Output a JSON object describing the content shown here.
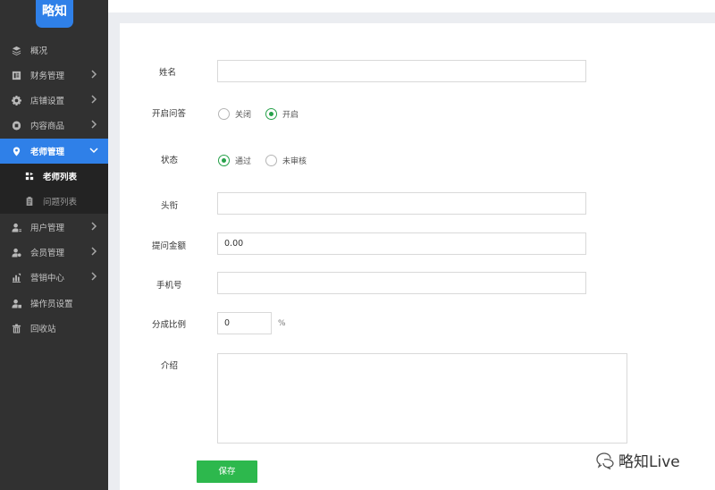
{
  "sidebar": {
    "logo_text": "略知",
    "items": [
      {
        "label": "概况",
        "icon": "layers-icon"
      },
      {
        "label": "财务管理",
        "icon": "ledger-icon"
      },
      {
        "label": "店铺设置",
        "icon": "gear-icon"
      },
      {
        "label": "内容商品",
        "icon": "product-icon"
      },
      {
        "label": "老师管理",
        "icon": "location-pin-icon",
        "active": true
      },
      {
        "label": "用户管理",
        "icon": "user-icon"
      },
      {
        "label": "会员管理",
        "icon": "member-icon"
      },
      {
        "label": "营销中心",
        "icon": "chart-icon"
      },
      {
        "label": "操作员设置",
        "icon": "operator-icon"
      },
      {
        "label": "回收站",
        "icon": "trash-icon"
      }
    ],
    "sub_items": [
      {
        "label": "老师列表",
        "icon": "teacher-list-icon",
        "current": true
      },
      {
        "label": "问题列表",
        "icon": "clipboard-icon"
      }
    ]
  },
  "form": {
    "name_label": "姓名",
    "name_value": "",
    "qa_label": "开启问答",
    "qa_options": [
      "关闭",
      "开启"
    ],
    "qa_selected": "开启",
    "status_label": "状态",
    "status_options": [
      "通过",
      "未审核"
    ],
    "status_selected": "通过",
    "title_label": "头衔",
    "title_value": "",
    "price_label": "提问金额",
    "price_value": "0.00",
    "phone_label": "手机号",
    "phone_value": "",
    "ratio_label": "分成比例",
    "ratio_value": "0",
    "ratio_unit": "%",
    "intro_label": "介绍",
    "intro_value": "",
    "save_label": "保存"
  },
  "watermark": {
    "text": "略知Live"
  },
  "colors": {
    "sidebar_bg": "#313131",
    "accent_blue": "#2f80e8",
    "save_green": "#2db84d",
    "radio_green": "#27a14a"
  }
}
